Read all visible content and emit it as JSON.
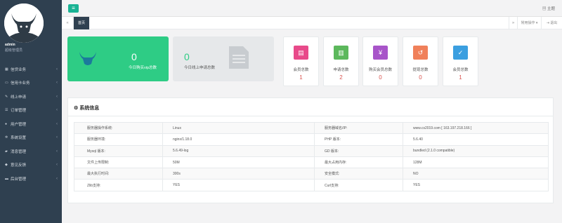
{
  "sidebar": {
    "user_name": "admin",
    "user_role": "超级管理员",
    "items": [
      {
        "label": "信贷业务",
        "icon": "calendar-icon"
      },
      {
        "label": "信用卡业务",
        "icon": "card-icon"
      },
      {
        "label": "线上申请",
        "icon": "edit-icon"
      },
      {
        "label": "订单管理",
        "icon": "list-icon"
      },
      {
        "label": "用户管理",
        "icon": "user-icon"
      },
      {
        "label": "系统设置",
        "icon": "gears-icon"
      },
      {
        "label": "消息管理",
        "icon": "chat-icon"
      },
      {
        "label": "意见反馈",
        "icon": "comment-icon"
      },
      {
        "label": "后台管理",
        "icon": "monitor-icon"
      }
    ]
  },
  "topbar": {
    "theme_label": "主题"
  },
  "tabs": {
    "home": "首页",
    "ops": "常用操作",
    "exit": "退出"
  },
  "summary": {
    "vip": {
      "value": "0",
      "label": "今日购买vip总数"
    },
    "apply": {
      "value": "0",
      "label": "今日线上申请总数"
    }
  },
  "stats": [
    {
      "label": "会员总数",
      "value": "1",
      "color": "#e84a8a",
      "icon": "document-icon"
    },
    {
      "label": "申请总数",
      "value": "2",
      "color": "#5cb85c",
      "icon": "ledger-icon"
    },
    {
      "label": "购买会员总数",
      "value": "0",
      "color": "#a855c9",
      "icon": "money-bag-icon"
    },
    {
      "label": "提现总数",
      "value": "0",
      "color": "#f0805a",
      "icon": "refund-icon"
    },
    {
      "label": "会员总数",
      "value": "1",
      "color": "#3b9fe0",
      "icon": "clipboard-check-icon"
    }
  ],
  "sysinfo": {
    "title": "系统信息",
    "rows": [
      [
        "服务器操作系统:",
        "Linux",
        "服务器域名/IP:",
        "www.cs2019.com [ 163.197.218.166 ]"
      ],
      [
        "服务器环境:",
        "nginx/1.18.0",
        "PHP 版本:",
        "5.6.40"
      ],
      [
        "Mysql 版本:",
        "5.6.49-log",
        "GD 版本:",
        "bundled (2.1.0 compatible)"
      ],
      [
        "文件上传限制:",
        "50M",
        "最大占用内存:",
        "128M"
      ],
      [
        "最大执行时间:",
        "300s",
        "安全模式:",
        "NO"
      ],
      [
        "Zlib支持:",
        "YES",
        "Curl支持:",
        "YES"
      ]
    ]
  },
  "colors": {
    "sidebar": "#2f4050",
    "accent": "#1ab394",
    "green_card": "#2ecc85",
    "value_red": "#d9534f"
  }
}
